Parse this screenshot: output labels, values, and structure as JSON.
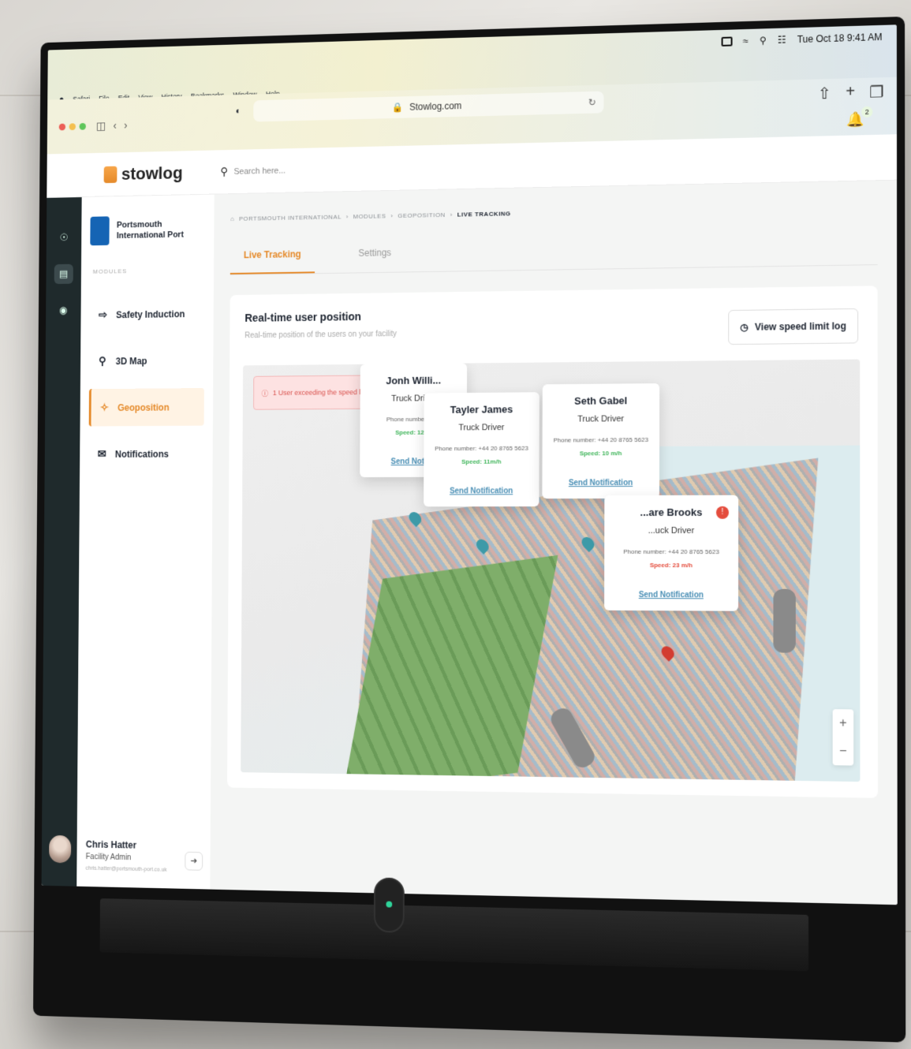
{
  "menubar": {
    "items": [
      "Safari",
      "File",
      "Edit",
      "View",
      "History",
      "Bookmarks",
      "Window",
      "Help"
    ],
    "clock": "Tue Oct 18  9:41 AM"
  },
  "browser": {
    "url": "Stowlog.com",
    "notification_count": "2"
  },
  "app": {
    "logo": "stowlog",
    "search_placeholder": "Search here..."
  },
  "organization": {
    "name_line1": "Portsmouth",
    "name_line2": "International Port"
  },
  "sidebar": {
    "section_label": "MODULES",
    "items": [
      {
        "label": "Safety Induction",
        "icon": "arrow-right-lines-icon"
      },
      {
        "label": "3D Map",
        "icon": "map-pin-3d-icon"
      },
      {
        "label": "Geoposition",
        "icon": "geoposition-icon"
      },
      {
        "label": "Notifications",
        "icon": "inbox-icon"
      }
    ]
  },
  "user": {
    "name": "Chris Hatter",
    "role": "Facility Admin",
    "email": "chris.hatter@portsmouth-port.co.uk"
  },
  "breadcrumb": [
    "PORTSMOUTH INTERNATIONAL",
    "MODULES",
    "GEOPOSITION",
    "LIVE TRACKING"
  ],
  "tabs": [
    "Live Tracking",
    "Settings"
  ],
  "card": {
    "title": "Real-time user position",
    "subtitle": "Real-time position of the users on your facility",
    "speed_log_button": "View speed limit log"
  },
  "alert": {
    "text": "1 User exceeding the speed li"
  },
  "drivers": [
    {
      "name": "Jonh Willi...",
      "role": "Truck Driv...",
      "phone": "Phone number: +44",
      "speed": "Speed: 12 m",
      "action": "Send Notific",
      "over_limit": false
    },
    {
      "name": "Tayler James",
      "role": "Truck Driver",
      "phone": "Phone number: +44 20 8765 5623",
      "speed": "Speed: 11m/h",
      "action": "Send Notification",
      "over_limit": false
    },
    {
      "name": "Seth Gabel",
      "role": "Truck Driver",
      "phone": "Phone number: +44 20 8765 5623",
      "speed": "Speed: 10 m/h",
      "action": "Send Notification",
      "over_limit": false
    },
    {
      "name": "...are Brooks",
      "role": "...uck Driver",
      "phone": "Phone number: +44 20 8765 5623",
      "speed": "Speed: 23 m/h",
      "action": "Send Notification",
      "over_limit": true
    }
  ],
  "zoom": {
    "in": "+",
    "out": "−"
  },
  "colors": {
    "accent": "#e58a2a",
    "rail": "#1f2a2c",
    "speed_ok": "#3fb55a",
    "speed_over": "#e44c3c",
    "link": "#4a8fb5"
  }
}
